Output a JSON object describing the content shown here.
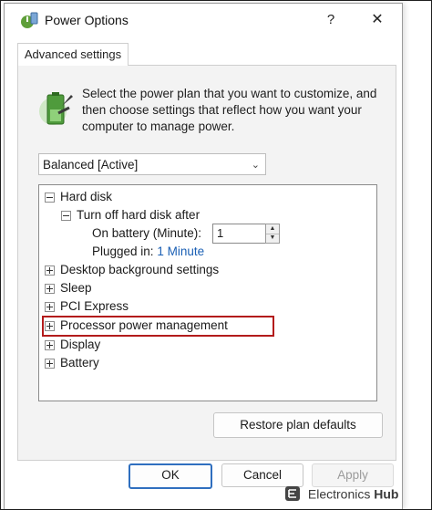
{
  "window": {
    "title": "Power Options",
    "help_label": "?",
    "close_label": "✕"
  },
  "tabs": [
    {
      "label": "Advanced settings"
    }
  ],
  "intro_text": "Select the power plan that you want to customize, and then choose settings that reflect how you want your computer to manage power.",
  "plan_select": {
    "value": "Balanced [Active]"
  },
  "tree": {
    "items": [
      {
        "label": "Hard disk",
        "state": "expanded"
      },
      {
        "label": "Turn off hard disk after",
        "state": "expanded"
      },
      {
        "label": "On battery (Minute):"
      },
      {
        "label": "Plugged in:",
        "value": "1 Minute"
      },
      {
        "label": "Desktop background settings",
        "state": "collapsed"
      },
      {
        "label": "Sleep",
        "state": "collapsed"
      },
      {
        "label": "PCI Express",
        "state": "collapsed"
      },
      {
        "label": "Processor power management",
        "state": "collapsed",
        "highlighted": true
      },
      {
        "label": "Display",
        "state": "collapsed"
      },
      {
        "label": "Battery",
        "state": "collapsed"
      }
    ],
    "battery_spin_value": "1"
  },
  "buttons": {
    "restore": "Restore plan defaults",
    "ok": "OK",
    "cancel": "Cancel",
    "apply": "Apply"
  },
  "watermark": {
    "text_a": "Electronics",
    "text_b": "Hub"
  },
  "colors": {
    "highlight_border": "#b31b1b",
    "link": "#1a5fb4",
    "ok_border": "#2f6fbf"
  }
}
